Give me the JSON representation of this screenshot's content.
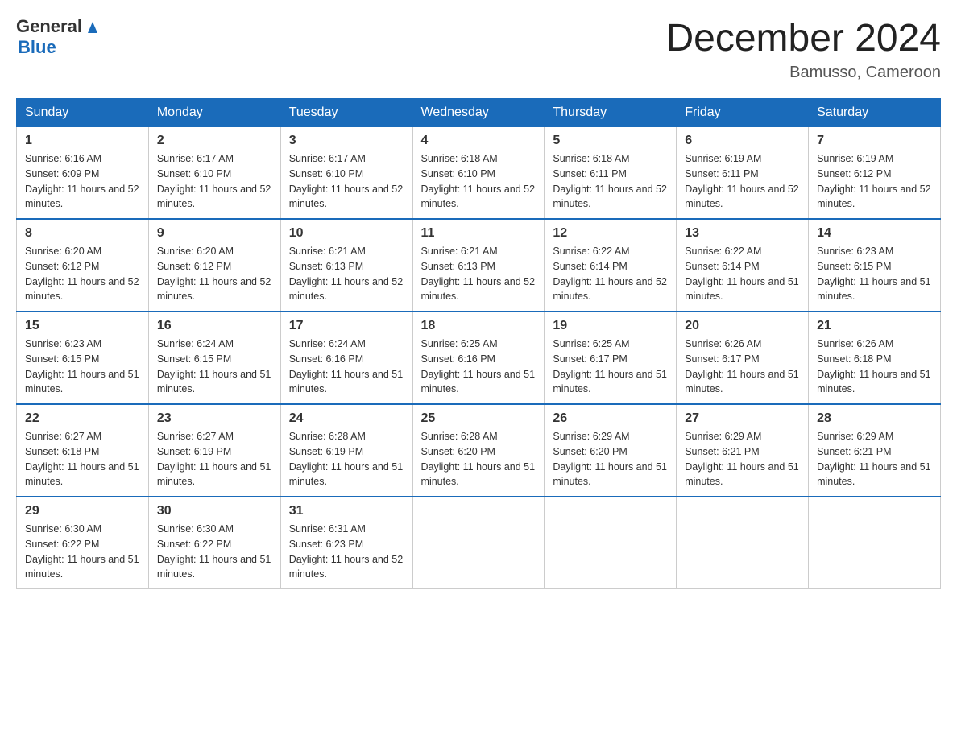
{
  "header": {
    "logo_general": "General",
    "logo_arrow": "▶",
    "logo_blue": "Blue",
    "month_title": "December 2024",
    "location": "Bamusso, Cameroon"
  },
  "weekdays": [
    "Sunday",
    "Monday",
    "Tuesday",
    "Wednesday",
    "Thursday",
    "Friday",
    "Saturday"
  ],
  "weeks": [
    [
      {
        "day": "1",
        "sunrise": "6:16 AM",
        "sunset": "6:09 PM",
        "daylight": "11 hours and 52 minutes."
      },
      {
        "day": "2",
        "sunrise": "6:17 AM",
        "sunset": "6:10 PM",
        "daylight": "11 hours and 52 minutes."
      },
      {
        "day": "3",
        "sunrise": "6:17 AM",
        "sunset": "6:10 PM",
        "daylight": "11 hours and 52 minutes."
      },
      {
        "day": "4",
        "sunrise": "6:18 AM",
        "sunset": "6:10 PM",
        "daylight": "11 hours and 52 minutes."
      },
      {
        "day": "5",
        "sunrise": "6:18 AM",
        "sunset": "6:11 PM",
        "daylight": "11 hours and 52 minutes."
      },
      {
        "day": "6",
        "sunrise": "6:19 AM",
        "sunset": "6:11 PM",
        "daylight": "11 hours and 52 minutes."
      },
      {
        "day": "7",
        "sunrise": "6:19 AM",
        "sunset": "6:12 PM",
        "daylight": "11 hours and 52 minutes."
      }
    ],
    [
      {
        "day": "8",
        "sunrise": "6:20 AM",
        "sunset": "6:12 PM",
        "daylight": "11 hours and 52 minutes."
      },
      {
        "day": "9",
        "sunrise": "6:20 AM",
        "sunset": "6:12 PM",
        "daylight": "11 hours and 52 minutes."
      },
      {
        "day": "10",
        "sunrise": "6:21 AM",
        "sunset": "6:13 PM",
        "daylight": "11 hours and 52 minutes."
      },
      {
        "day": "11",
        "sunrise": "6:21 AM",
        "sunset": "6:13 PM",
        "daylight": "11 hours and 52 minutes."
      },
      {
        "day": "12",
        "sunrise": "6:22 AM",
        "sunset": "6:14 PM",
        "daylight": "11 hours and 52 minutes."
      },
      {
        "day": "13",
        "sunrise": "6:22 AM",
        "sunset": "6:14 PM",
        "daylight": "11 hours and 51 minutes."
      },
      {
        "day": "14",
        "sunrise": "6:23 AM",
        "sunset": "6:15 PM",
        "daylight": "11 hours and 51 minutes."
      }
    ],
    [
      {
        "day": "15",
        "sunrise": "6:23 AM",
        "sunset": "6:15 PM",
        "daylight": "11 hours and 51 minutes."
      },
      {
        "day": "16",
        "sunrise": "6:24 AM",
        "sunset": "6:15 PM",
        "daylight": "11 hours and 51 minutes."
      },
      {
        "day": "17",
        "sunrise": "6:24 AM",
        "sunset": "6:16 PM",
        "daylight": "11 hours and 51 minutes."
      },
      {
        "day": "18",
        "sunrise": "6:25 AM",
        "sunset": "6:16 PM",
        "daylight": "11 hours and 51 minutes."
      },
      {
        "day": "19",
        "sunrise": "6:25 AM",
        "sunset": "6:17 PM",
        "daylight": "11 hours and 51 minutes."
      },
      {
        "day": "20",
        "sunrise": "6:26 AM",
        "sunset": "6:17 PM",
        "daylight": "11 hours and 51 minutes."
      },
      {
        "day": "21",
        "sunrise": "6:26 AM",
        "sunset": "6:18 PM",
        "daylight": "11 hours and 51 minutes."
      }
    ],
    [
      {
        "day": "22",
        "sunrise": "6:27 AM",
        "sunset": "6:18 PM",
        "daylight": "11 hours and 51 minutes."
      },
      {
        "day": "23",
        "sunrise": "6:27 AM",
        "sunset": "6:19 PM",
        "daylight": "11 hours and 51 minutes."
      },
      {
        "day": "24",
        "sunrise": "6:28 AM",
        "sunset": "6:19 PM",
        "daylight": "11 hours and 51 minutes."
      },
      {
        "day": "25",
        "sunrise": "6:28 AM",
        "sunset": "6:20 PM",
        "daylight": "11 hours and 51 minutes."
      },
      {
        "day": "26",
        "sunrise": "6:29 AM",
        "sunset": "6:20 PM",
        "daylight": "11 hours and 51 minutes."
      },
      {
        "day": "27",
        "sunrise": "6:29 AM",
        "sunset": "6:21 PM",
        "daylight": "11 hours and 51 minutes."
      },
      {
        "day": "28",
        "sunrise": "6:29 AM",
        "sunset": "6:21 PM",
        "daylight": "11 hours and 51 minutes."
      }
    ],
    [
      {
        "day": "29",
        "sunrise": "6:30 AM",
        "sunset": "6:22 PM",
        "daylight": "11 hours and 51 minutes."
      },
      {
        "day": "30",
        "sunrise": "6:30 AM",
        "sunset": "6:22 PM",
        "daylight": "11 hours and 51 minutes."
      },
      {
        "day": "31",
        "sunrise": "6:31 AM",
        "sunset": "6:23 PM",
        "daylight": "11 hours and 52 minutes."
      },
      null,
      null,
      null,
      null
    ]
  ]
}
